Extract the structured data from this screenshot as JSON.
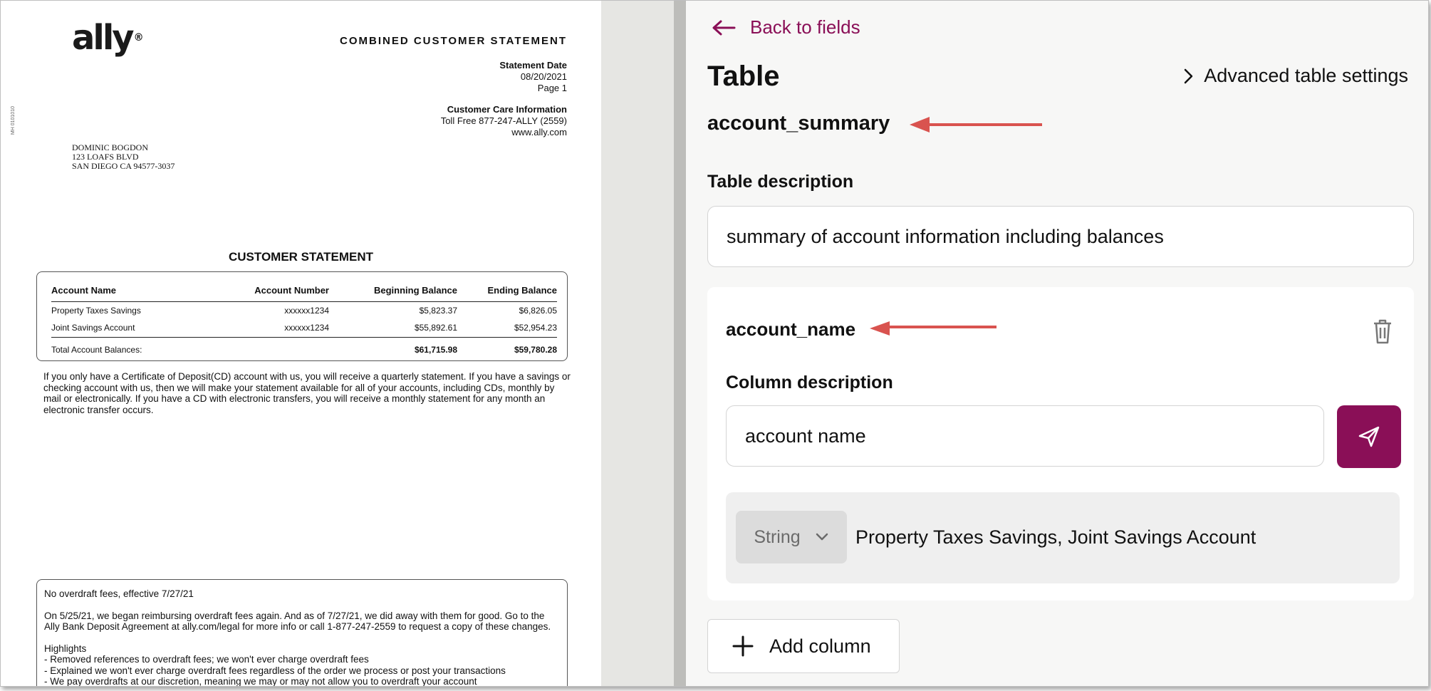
{
  "document": {
    "logo": "ally",
    "side_code": "MH 0101010",
    "heading": "COMBINED CUSTOMER STATEMENT",
    "statement_date_label": "Statement Date",
    "statement_date": "08/20/2021",
    "page": "Page 1",
    "care_label": "Customer Care Information",
    "toll_free": "Toll Free 877-247-ALLY (2559)",
    "website": "www.ally.com",
    "address": [
      "DOMINIC BOGDON",
      "123 LOAFS BLVD",
      "SAN DIEGO CA  94577-3037"
    ],
    "section_title": "CUSTOMER STATEMENT",
    "summary": {
      "headers": [
        "Account Name",
        "Account Number",
        "Beginning Balance",
        "Ending Balance"
      ],
      "rows": [
        [
          "Property Taxes Savings",
          "xxxxxx1234",
          "$5,823.37",
          "$6,826.05"
        ],
        [
          "Joint Savings Account",
          "xxxxxx1234",
          "$55,892.61",
          "$52,954.23"
        ]
      ],
      "total_label": "Total Account Balances:",
      "total_beginning": "$61,715.98",
      "total_ending": "$59,780.28"
    },
    "paragraph": "If you only have a Certificate of Deposit(CD) account with us, you will receive a quarterly statement.  If you have a savings or checking account with us, then we will make your statement available for all of your accounts, including CDs, monthly by mail or electronically.  If you have a CD with electronic transfers, you will receive a monthly statement for any month an electronic transfer occurs.",
    "notice": {
      "title": "No overdraft fees, effective 7/27/21",
      "body": "On 5/25/21, we began reimbursing overdraft fees again. And as of 7/27/21, we did away with them for good. Go to the Ally Bank Deposit Agreement at ally.com/legal for more info or call 1-877-247-2559 to request a copy of these changes.",
      "highlights_label": "Highlights",
      "highlights": [
        " - Removed references to overdraft fees; we won't ever charge overdraft fees",
        " - Explained we won't ever charge overdraft fees regardless of the order we process or post your transactions",
        " - We pay overdrafts at our discretion, meaning we may or may not allow you to overdraft your account"
      ]
    }
  },
  "panel": {
    "back_label": "Back to fields",
    "title": "Table",
    "advanced_label": "Advanced table settings",
    "table_name": "account_summary",
    "table_description_label": "Table description",
    "table_description": "summary of account information including balances",
    "column": {
      "name": "account_name",
      "description_label": "Column description",
      "description": "account name",
      "type": "String",
      "examples": "Property Taxes Savings, Joint Savings Account"
    },
    "add_column_label": "Add column"
  },
  "colors": {
    "accent": "#8a0f57",
    "annotation_arrow": "#d9534f"
  }
}
